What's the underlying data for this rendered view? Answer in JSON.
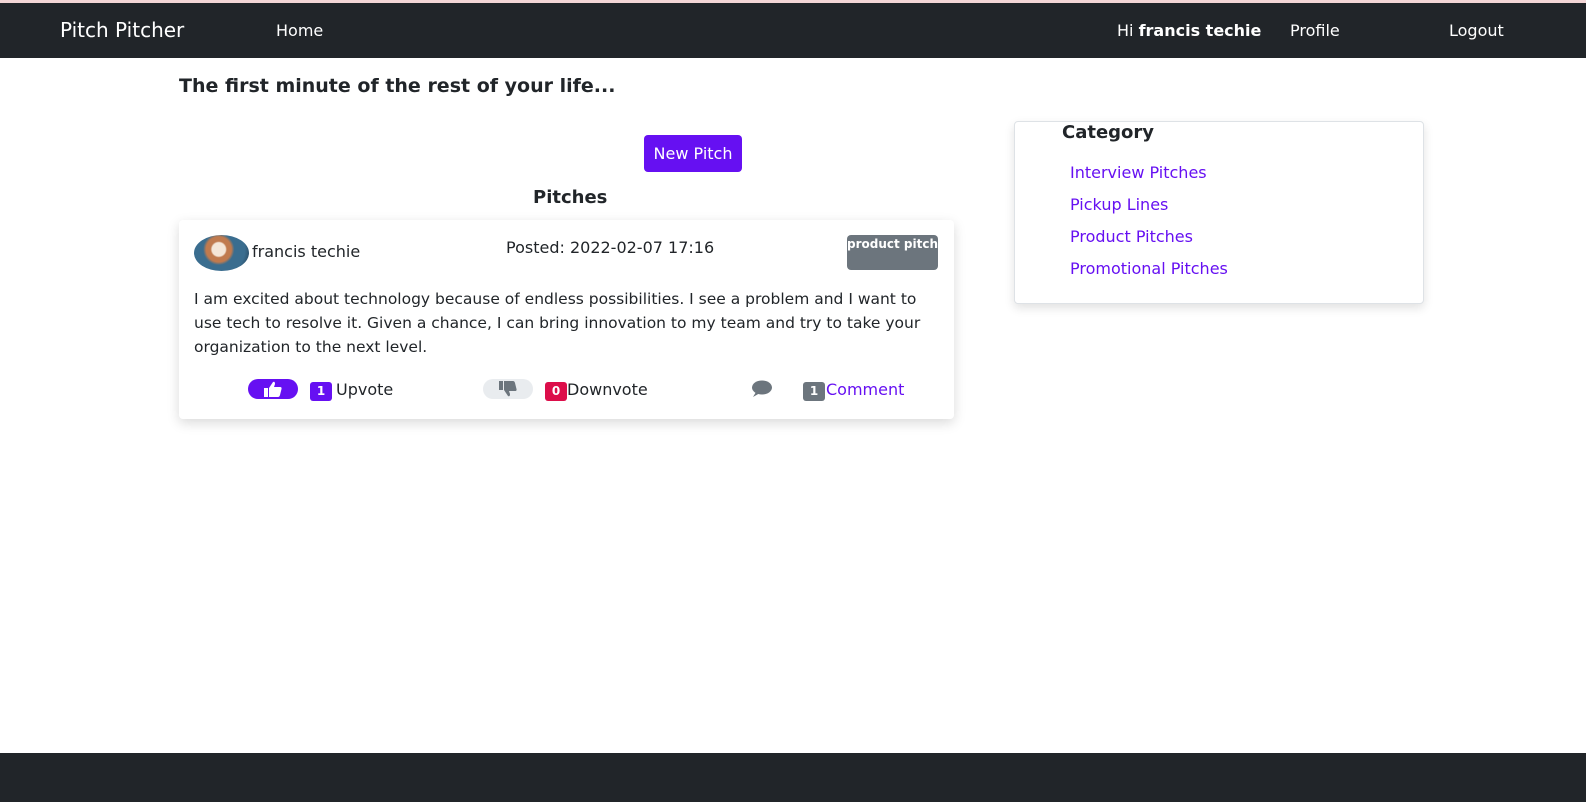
{
  "navbar": {
    "brand": "Pitch Pitcher",
    "home": "Home",
    "greeting_prefix": "Hi ",
    "username": "francis techie",
    "profile": "Profile",
    "logout": "Logout"
  },
  "main": {
    "tagline": "The first minute of the rest of your life...",
    "new_pitch_label": "New Pitch",
    "pitches_heading": "Pitches"
  },
  "pitch": {
    "author": "francis techie",
    "posted": "Posted: 2022-02-07 17:16",
    "category": "product pitch",
    "body": "I am excited about technology because of endless possibilities. I see a problem and I want to use tech to resolve it. Given a chance, I can bring innovation to my team and try to take your organization to the next level.",
    "upvotes": "1",
    "upvote_label": "Upvote",
    "downvotes": "0",
    "downvote_label": "Downvote",
    "comments": "1",
    "comment_label": "Comment"
  },
  "sidebar": {
    "title": "Category",
    "items": [
      {
        "label": "Interview Pitches"
      },
      {
        "label": "Pickup Lines"
      },
      {
        "label": "Product Pitches"
      },
      {
        "label": "Promotional Pitches"
      }
    ]
  },
  "icons": {
    "upvote": "thumbs-up-icon",
    "downvote": "thumbs-down-icon",
    "comment": "comment-icon"
  },
  "colors": {
    "primary": "#6610f2",
    "dark": "#212529",
    "danger": "#dc0e4a",
    "secondary": "#6c757d"
  }
}
